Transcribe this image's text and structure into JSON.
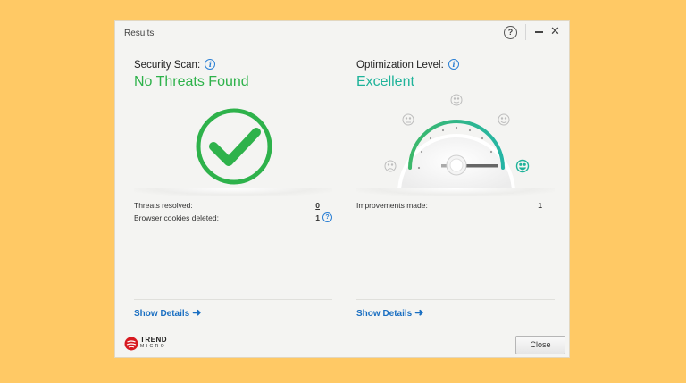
{
  "window": {
    "title": "Results",
    "help_glyph": "?",
    "close_glyph": "✕"
  },
  "left": {
    "heading": "Security Scan:",
    "status": "No Threats Found",
    "status_color": "#2EB24B",
    "stats": [
      {
        "label": "Threats resolved:",
        "value": "0"
      },
      {
        "label": "Browser cookies deleted:",
        "value": "1"
      }
    ],
    "details_label": "Show Details"
  },
  "right": {
    "heading": "Optimization Level:",
    "status": "Excellent",
    "status_color": "#1FB39A",
    "gauge_level": 1.0,
    "stats": [
      {
        "label": "Improvements made:",
        "value": "1"
      }
    ],
    "details_label": "Show Details"
  },
  "footer": {
    "brand_line1": "TREND",
    "brand_line2": "MICRO",
    "close_label": "Close"
  },
  "colors": {
    "background": "#FFC965",
    "window": "#F4F4F2",
    "link": "#1A6FC2",
    "brand_red": "#D71920"
  },
  "icons": {
    "info": "info-icon",
    "help": "question-icon",
    "check": "checkmark-icon",
    "arrow": "arrow-right-icon"
  }
}
